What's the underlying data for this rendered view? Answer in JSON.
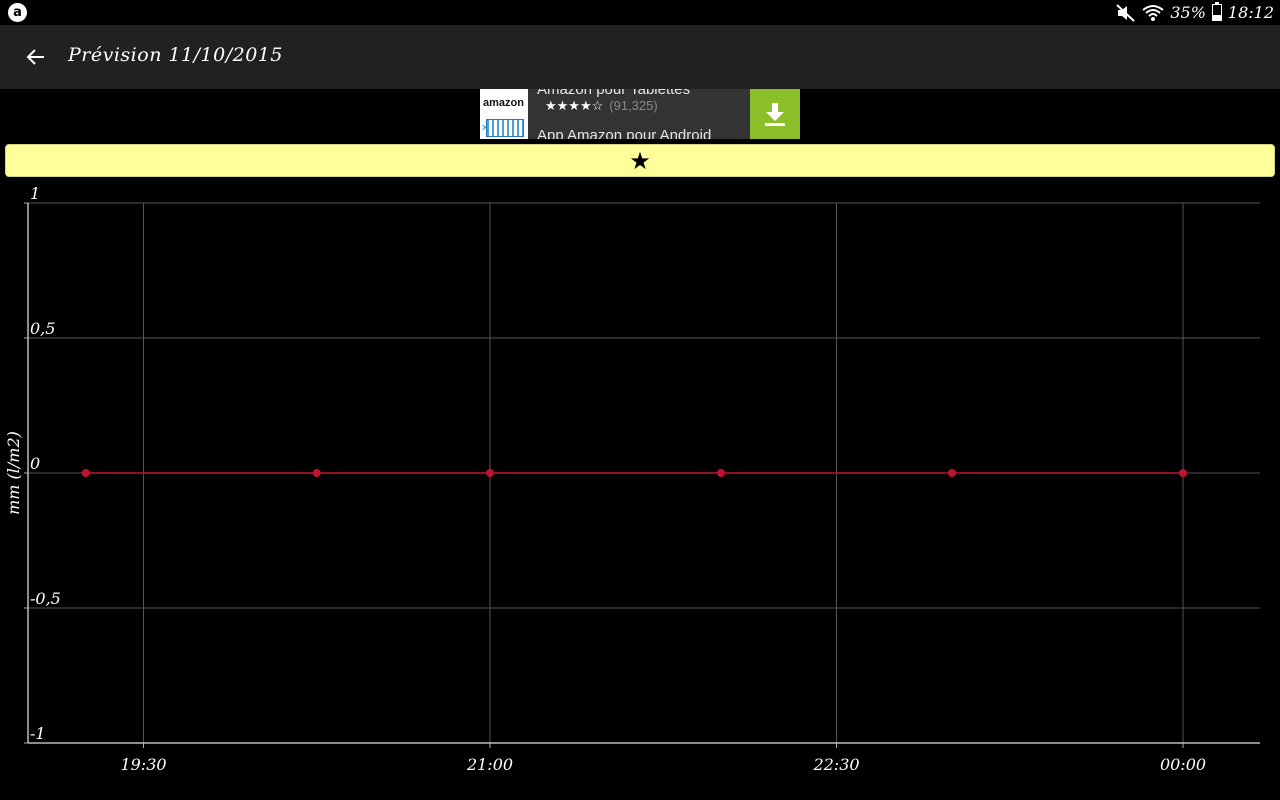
{
  "status_bar": {
    "battery": "35%",
    "time": "18:12",
    "icons": [
      "mute-icon",
      "wifi-icon",
      "battery-icon"
    ]
  },
  "app_bar": {
    "title": "Prévision 11/10/2015",
    "back_icon": "arrow-left-icon"
  },
  "ad": {
    "brand": "amazon",
    "title": "Amazon pour Tablettes",
    "stars": "★★★★☆",
    "rating_count": "(91,325)",
    "subtitle": "App Amazon pour Android",
    "download_icon": "download-icon",
    "accent": "#8bbf2a"
  },
  "favorite_bar": {
    "icon": "star-icon",
    "glyph": "★",
    "color": "#ffff99"
  },
  "chart_data": {
    "type": "line",
    "ylabel": "mm (l/m2)",
    "xlabel": "",
    "ylim": [
      -1,
      1
    ],
    "xlim": [
      "19:00",
      "00:20"
    ],
    "x_ticks": [
      "19:30",
      "21:00",
      "22:30",
      "00:00"
    ],
    "y_ticks": [
      {
        "value": 1,
        "label": "1"
      },
      {
        "value": 0.5,
        "label": "0,5"
      },
      {
        "value": 0,
        "label": "0"
      },
      {
        "value": -0.5,
        "label": "-0,5"
      },
      {
        "value": -1,
        "label": "-1"
      }
    ],
    "grid": true,
    "series": [
      {
        "color": "#c0142c",
        "x": [
          "19:15",
          "20:15",
          "21:00",
          "22:00",
          "23:00",
          "00:00"
        ],
        "values": [
          0,
          0,
          0,
          0,
          0,
          0
        ]
      }
    ]
  }
}
